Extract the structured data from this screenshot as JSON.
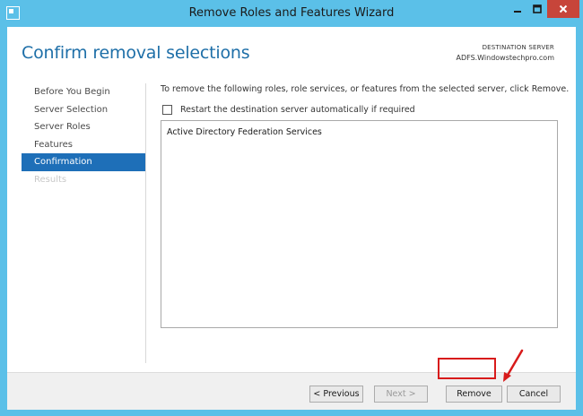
{
  "window": {
    "title": "Remove Roles and Features Wizard",
    "controls": [
      "minimize-icon",
      "maximize-icon",
      "close-icon"
    ],
    "accent_color": "#5bc0e8"
  },
  "header": {
    "title": "Confirm removal selections",
    "destination_label": "DESTINATION SERVER",
    "destination_server": "ADFS.Windowstechpro.com"
  },
  "nav": {
    "items": [
      {
        "label": "Before You Begin",
        "state": "normal"
      },
      {
        "label": "Server Selection",
        "state": "normal"
      },
      {
        "label": "Server Roles",
        "state": "normal"
      },
      {
        "label": "Features",
        "state": "normal"
      },
      {
        "label": "Confirmation",
        "state": "active"
      },
      {
        "label": "Results",
        "state": "disabled"
      }
    ],
    "active_color": "#1e6fb8"
  },
  "main": {
    "instruction": "To remove the following roles, role services, or features from the selected server, click Remove.",
    "restart_checkbox": {
      "label": "Restart the destination server automatically if required",
      "checked": false
    },
    "items": [
      "Active Directory Federation Services"
    ]
  },
  "footer": {
    "previous_label": "< Previous",
    "next_label": "Next >",
    "remove_label": "Remove",
    "cancel_label": "Cancel",
    "highlight_color": "#d81b1b"
  }
}
